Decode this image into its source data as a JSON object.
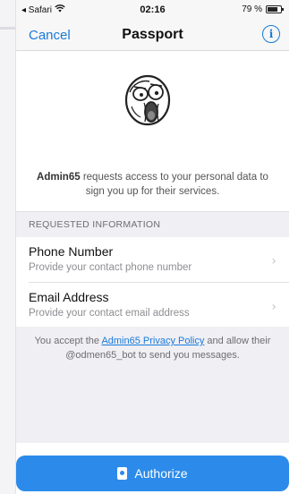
{
  "status_bar": {
    "carrier": "◂ Safari",
    "wifi_icon": "wifi-icon",
    "time": "02:16",
    "battery": "79 %"
  },
  "nav": {
    "cancel_label": "Cancel",
    "title": "Passport",
    "info_icon": "info-icon",
    "info_glyph": "i"
  },
  "header": {
    "bot_name": "Admin65",
    "description": " requests access to your personal data to sign you up for their services."
  },
  "section": {
    "title": "REQUESTED INFORMATION"
  },
  "items": [
    {
      "title": "Phone Number",
      "subtitle": "Provide your contact phone number"
    },
    {
      "title": "Email Address",
      "subtitle": "Provide your contact email address"
    }
  ],
  "footer": {
    "prefix": "You accept the ",
    "link": "Admin65 Privacy Policy",
    "suffix": " and allow their @odmen65_bot to send you messages."
  },
  "authorize": {
    "label": "Authorize",
    "icon": "passport-icon"
  },
  "colors": {
    "accent": "#1a7ad9",
    "button": "#2c8bea",
    "background": "#efeff4"
  }
}
